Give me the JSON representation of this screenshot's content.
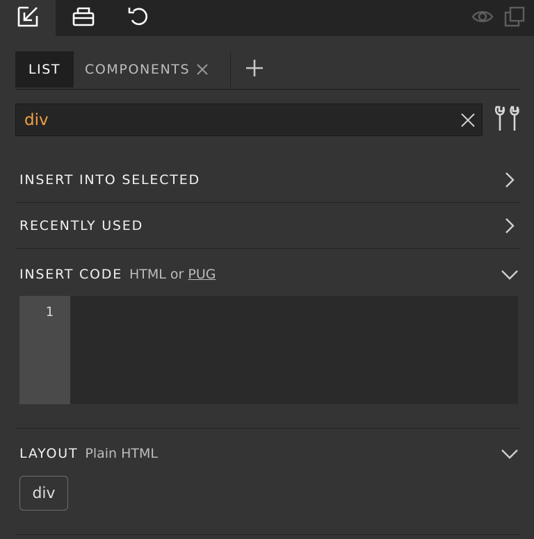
{
  "toolbar": {
    "buttons": [
      {
        "icon": "insert-panel-icon",
        "active": true
      },
      {
        "icon": "print-icon",
        "active": false
      },
      {
        "icon": "undo-icon",
        "active": false
      }
    ],
    "right_icons": [
      "eye-icon",
      "duplicate-icon"
    ]
  },
  "tabs": {
    "list_label": "LIST",
    "components_label": "COMPONENTS",
    "add_symbol": "+"
  },
  "search": {
    "value": "div",
    "placeholder": ""
  },
  "sections": {
    "insert_into_selected": "INSERT INTO SELECTED",
    "recently_used": "RECENTLY USED",
    "insert_code": {
      "title": "INSERT CODE",
      "sub_prefix": "HTML or",
      "sub_link": "PUG"
    },
    "layout": {
      "title": "LAYOUT",
      "sub": "Plain HTML"
    }
  },
  "editor": {
    "line_numbers": [
      "1"
    ],
    "content": ""
  },
  "layout_chips": [
    "div"
  ],
  "colors": {
    "accent_search_text": "#f0a143",
    "panel_bg": "#343434",
    "toolbar_bg": "#242424"
  }
}
